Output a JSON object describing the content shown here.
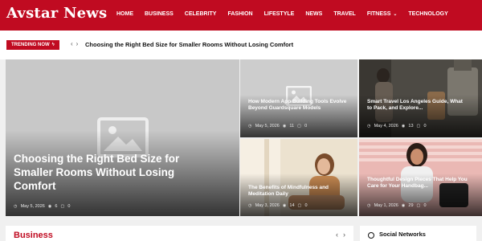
{
  "header": {
    "logo": "Avstar News",
    "nav": [
      "HOME",
      "BUSINESS",
      "CELEBRITY",
      "FASHION",
      "LIFESTYLE",
      "NEWS",
      "TRAVEL",
      "FITNESS",
      "TECHNOLOGY"
    ]
  },
  "trending": {
    "label": "TRENDING NOW",
    "headline": "Choosing the Right Bed Size for Smaller Rooms Without Losing Comfort"
  },
  "featured": {
    "title": "Choosing the Right Bed Size for Smaller Rooms Without Losing Comfort",
    "date": "May 5, 2026",
    "views": "6",
    "comments": "0"
  },
  "cards": [
    {
      "title": "How Modern App Building Tools Evolve Beyond Guardsquare Models",
      "date": "May 5, 2026",
      "views": "11",
      "comments": "0"
    },
    {
      "title": "Smart Travel Los Angeles Guide, What to Pack, and Explore...",
      "date": "May 4, 2026",
      "views": "13",
      "comments": "0"
    },
    {
      "title": "The Benefits of Mindfulness and Meditation Daily",
      "date": "May 3, 2026",
      "views": "14",
      "comments": "0"
    },
    {
      "title": "Thoughtful Design Pieces That Help You Care for Your Handbag...",
      "date": "May 1, 2026",
      "views": "29",
      "comments": "0"
    }
  ],
  "sections": {
    "business": "Business",
    "social": "Social Networks"
  },
  "colors": {
    "brand": "#c00b21"
  }
}
